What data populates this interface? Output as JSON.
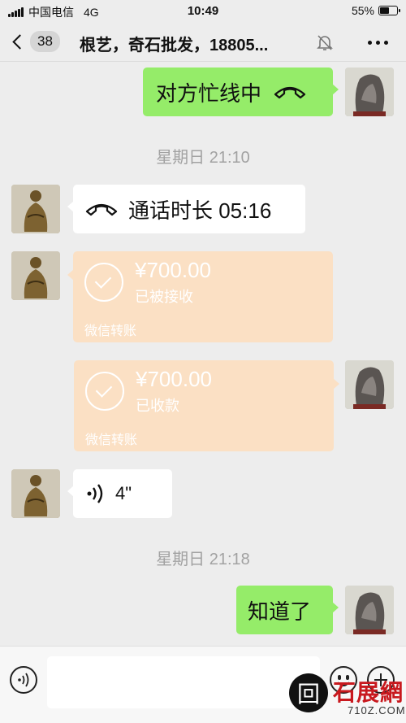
{
  "status_bar": {
    "carrier": "中国电信",
    "network": "4G",
    "time": "10:49",
    "battery": "55%",
    "battery_level": 0.55
  },
  "nav": {
    "unread_count": "38",
    "title": "根艺，奇石批发，18805..."
  },
  "messages": {
    "m1": {
      "text": "对方忙线中"
    },
    "ts1": "星期日 21:10",
    "m2": {
      "text": "通话时长 05:16"
    },
    "t1": {
      "amount": "¥700.00",
      "status": "已被接收",
      "footer": "微信转账"
    },
    "t2": {
      "amount": "¥700.00",
      "status": "已收款",
      "footer": "微信转账"
    },
    "v1": {
      "duration": "4\""
    },
    "ts2": "星期日 21:18",
    "m3": {
      "text": "知道了"
    }
  },
  "watermark": {
    "brand": "石展網",
    "domain": "710Z.COM",
    "seal": "回"
  },
  "colors": {
    "self_bubble": "#95ec69",
    "other_bubble": "#ffffff",
    "transfer_card": "#fbe0c4",
    "background": "#ededed"
  }
}
